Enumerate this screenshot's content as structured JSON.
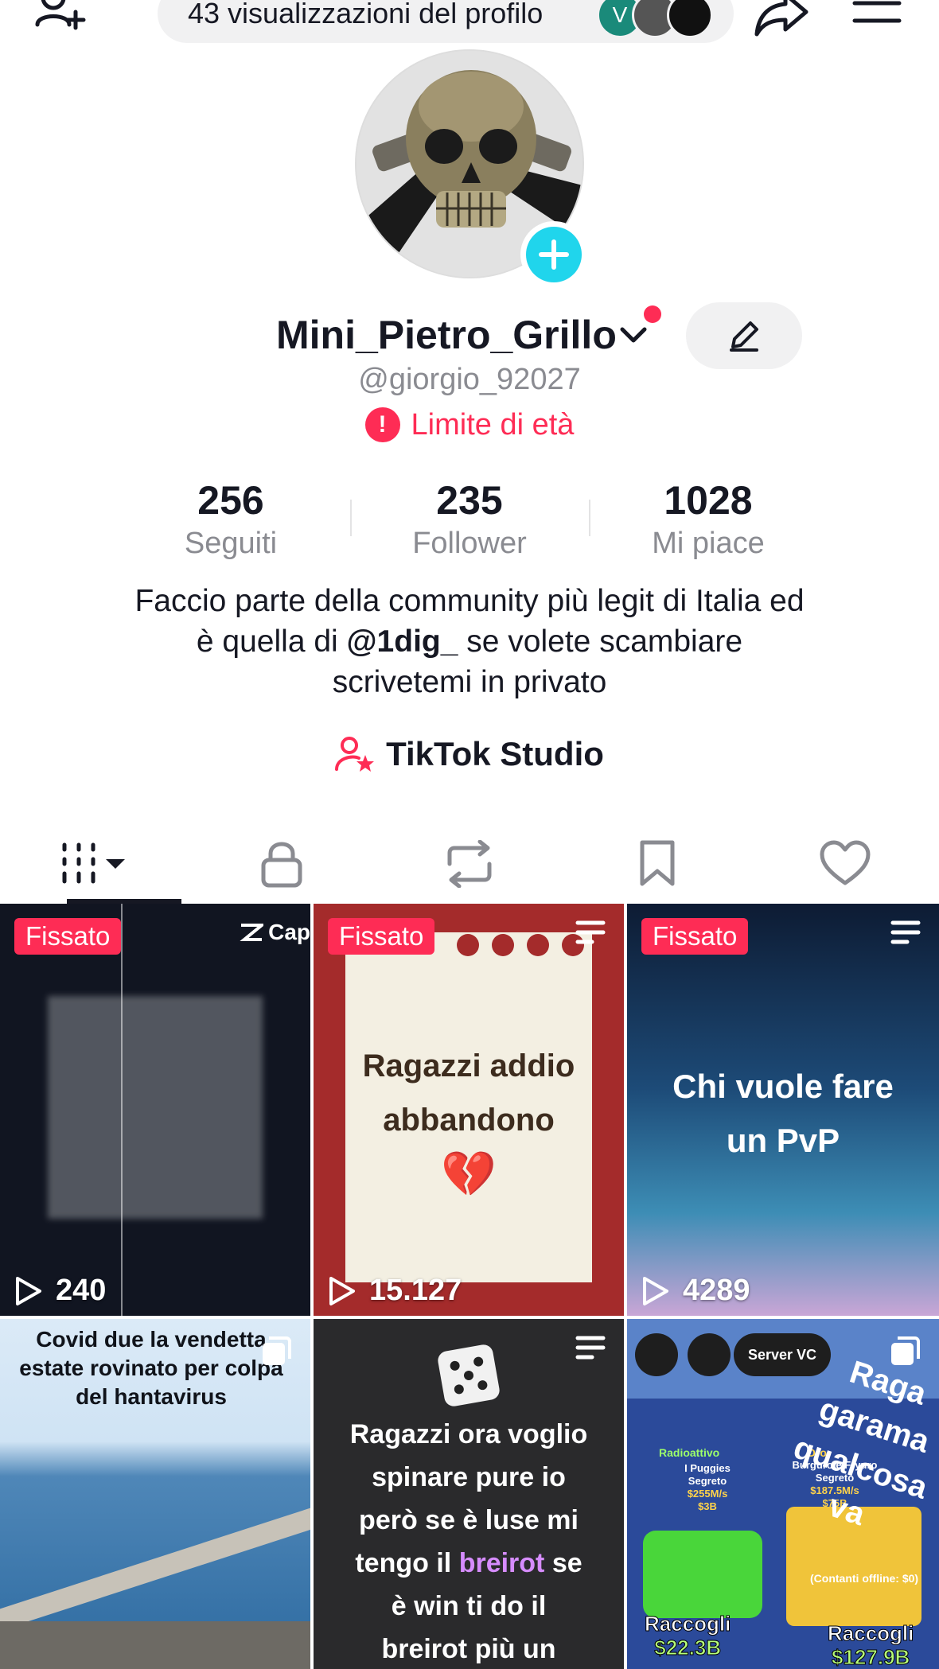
{
  "top_bar": {
    "views_text": "43 visualizzazioni del profilo",
    "avatar_initial": "V"
  },
  "profile": {
    "display_name": "Mini_Pietro_Grillo",
    "username": "@giorgio_92027",
    "age_limit": "Limite di età",
    "age_limit_mark": "!"
  },
  "stats": [
    {
      "value": "256",
      "label": "Seguiti"
    },
    {
      "value": "235",
      "label": "Follower"
    },
    {
      "value": "1028",
      "label": "Mi piace"
    }
  ],
  "bio": {
    "line1": "Faccio parte della community più legit di Italia ed",
    "line2_pre": "è quella di ",
    "mention": "@1dig_",
    "line2_post": " se volete scambiare",
    "line3": "scrivetemi in privato"
  },
  "studio_label": "TikTok Studio",
  "videos": [
    {
      "pinned": "Fissato",
      "plays": "240",
      "brand": "Cap"
    },
    {
      "pinned": "Fissato",
      "plays": "15.127",
      "caption_1": "Ragazzi addio",
      "caption_2": "abbandono",
      "emoji": "💔"
    },
    {
      "pinned": "Fissato",
      "plays": "4289",
      "caption_1": "Chi vuole fare",
      "caption_2": "un PvP"
    },
    {
      "caption_1": "Covid due la vendetta",
      "caption_2": "estate rovinato per colpa",
      "caption_3": "del hantavirus"
    },
    {
      "caption_1": "Ragazzi ora voglio",
      "caption_2": "spinare pure io",
      "caption_3": "però se è luse mi",
      "caption_4_pre": "tengo il ",
      "caption_4_hl": "breirot",
      "caption_4_post": " se",
      "caption_5": "è win ti do il",
      "caption_6": "breirot più un"
    },
    {
      "server": "Server VC",
      "tag_1": "Radioattivo",
      "tag_2": "Oro",
      "item_1": "I Puggies",
      "item_1_sub": "Segreto",
      "item_1_rate": "$255M/s",
      "item_1_price": "$3B",
      "item_2": "Burguro e Fryuro",
      "item_2_sub": "Segreto",
      "item_2_rate": "$187.5M/s",
      "item_2_price": "$75B",
      "collect_1": "Raccogli",
      "collect_1_amt": "$22.3B",
      "collect_2": "Raccogli",
      "collect_2_amt": "$127.9B",
      "offline": "(Contanti offline: $0)",
      "side_1": "Raga",
      "side_2": "garama",
      "side_3": "qualcosa",
      "side_4": "va"
    }
  ],
  "colors": {
    "accent_red": "#fe2c55",
    "accent_cyan": "#20d5ec",
    "text_primary": "#161823",
    "text_secondary": "#8a8b91",
    "highlight_purple": "#d68cff"
  }
}
